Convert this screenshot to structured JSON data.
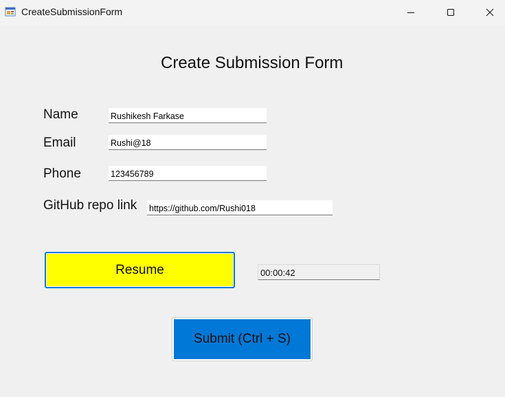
{
  "window": {
    "title": "CreateSubmissionForm",
    "icon": "winforms-app-icon"
  },
  "form": {
    "title": "Create Submission Form",
    "fields": {
      "name": {
        "label": "Name",
        "value": "Rushikesh Farkase"
      },
      "email": {
        "label": "Email",
        "value": "Rushi@18"
      },
      "phone": {
        "label": "Phone",
        "value": "123456789"
      },
      "github": {
        "label": "GitHub repo link",
        "value": "https://github.com/Rushi018"
      }
    },
    "resume_label": "Resume",
    "timer": "00:00:42",
    "submit_label": "Submit (Ctrl + S)"
  },
  "colors": {
    "resume_bg": "#ffff00",
    "submit_bg": "#0078d7",
    "focus_border": "#0078d7"
  }
}
